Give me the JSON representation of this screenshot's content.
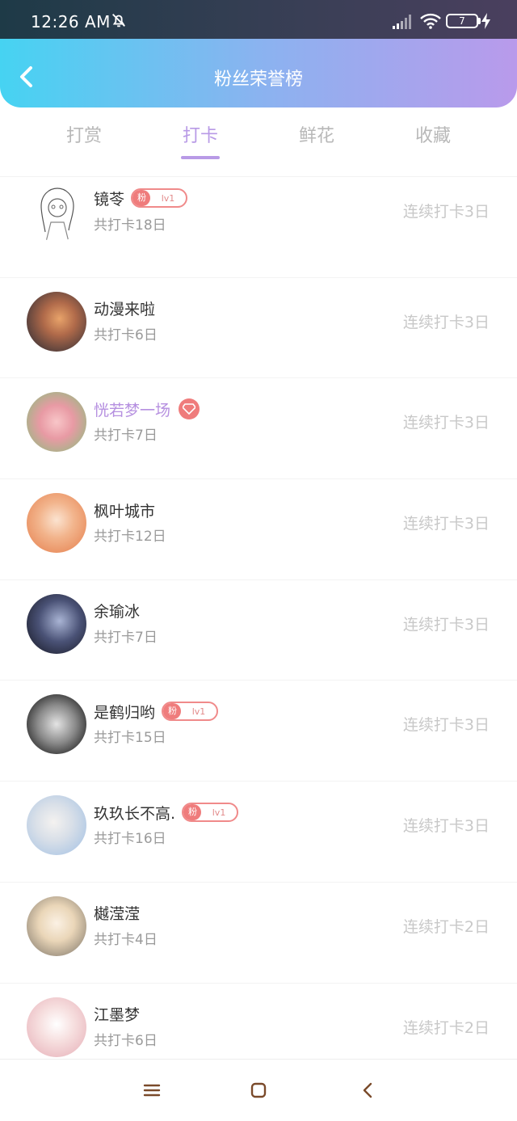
{
  "status_bar": {
    "time": "12:26 AM",
    "battery": "7",
    "icons": [
      "bell-off-icon",
      "signal-icon",
      "wifi-icon",
      "battery-icon",
      "charging-icon"
    ]
  },
  "header": {
    "title": "粉丝荣誉榜",
    "back_icon": "chevron-left-icon",
    "gradient": [
      "#46d3f2",
      "#b99aeb"
    ]
  },
  "tabs": [
    {
      "label": "打赏",
      "active": false
    },
    {
      "label": "打卡",
      "active": true
    },
    {
      "label": "鲜花",
      "active": false
    },
    {
      "label": "收藏",
      "active": false
    }
  ],
  "colors": {
    "accent": "#b89ae6",
    "badge": "#ef7c7c",
    "streak_text": "#c8c8c8"
  },
  "fans": [
    {
      "name": "镜苓",
      "total": "共打卡18日",
      "streak": "连续打卡3日",
      "badge": {
        "tag": "粉",
        "level": "lv1"
      }
    },
    {
      "name": "动漫来啦",
      "total": "共打卡6日",
      "streak": "连续打卡3日"
    },
    {
      "name": "恍若梦一场",
      "total": "共打卡7日",
      "streak": "连续打卡3日",
      "vip": true
    },
    {
      "name": "枫叶城市",
      "total": "共打卡12日",
      "streak": "连续打卡3日"
    },
    {
      "name": "余瑜冰",
      "total": "共打卡7日",
      "streak": "连续打卡3日"
    },
    {
      "name": "是鹤归哟",
      "total": "共打卡15日",
      "streak": "连续打卡3日",
      "badge": {
        "tag": "粉",
        "level": "lv1"
      }
    },
    {
      "name": "玖玖长不高.",
      "total": "共打卡16日",
      "streak": "连续打卡3日",
      "badge": {
        "tag": "粉",
        "level": "lv1"
      }
    },
    {
      "name": "樾滢滢",
      "total": "共打卡4日",
      "streak": "连续打卡2日"
    },
    {
      "name": "江墨梦",
      "total": "共打卡6日",
      "streak": "连续打卡2日"
    }
  ],
  "nav_bar": {
    "icons": [
      "menu-icon",
      "home-square-icon",
      "back-triangle-icon"
    ]
  }
}
